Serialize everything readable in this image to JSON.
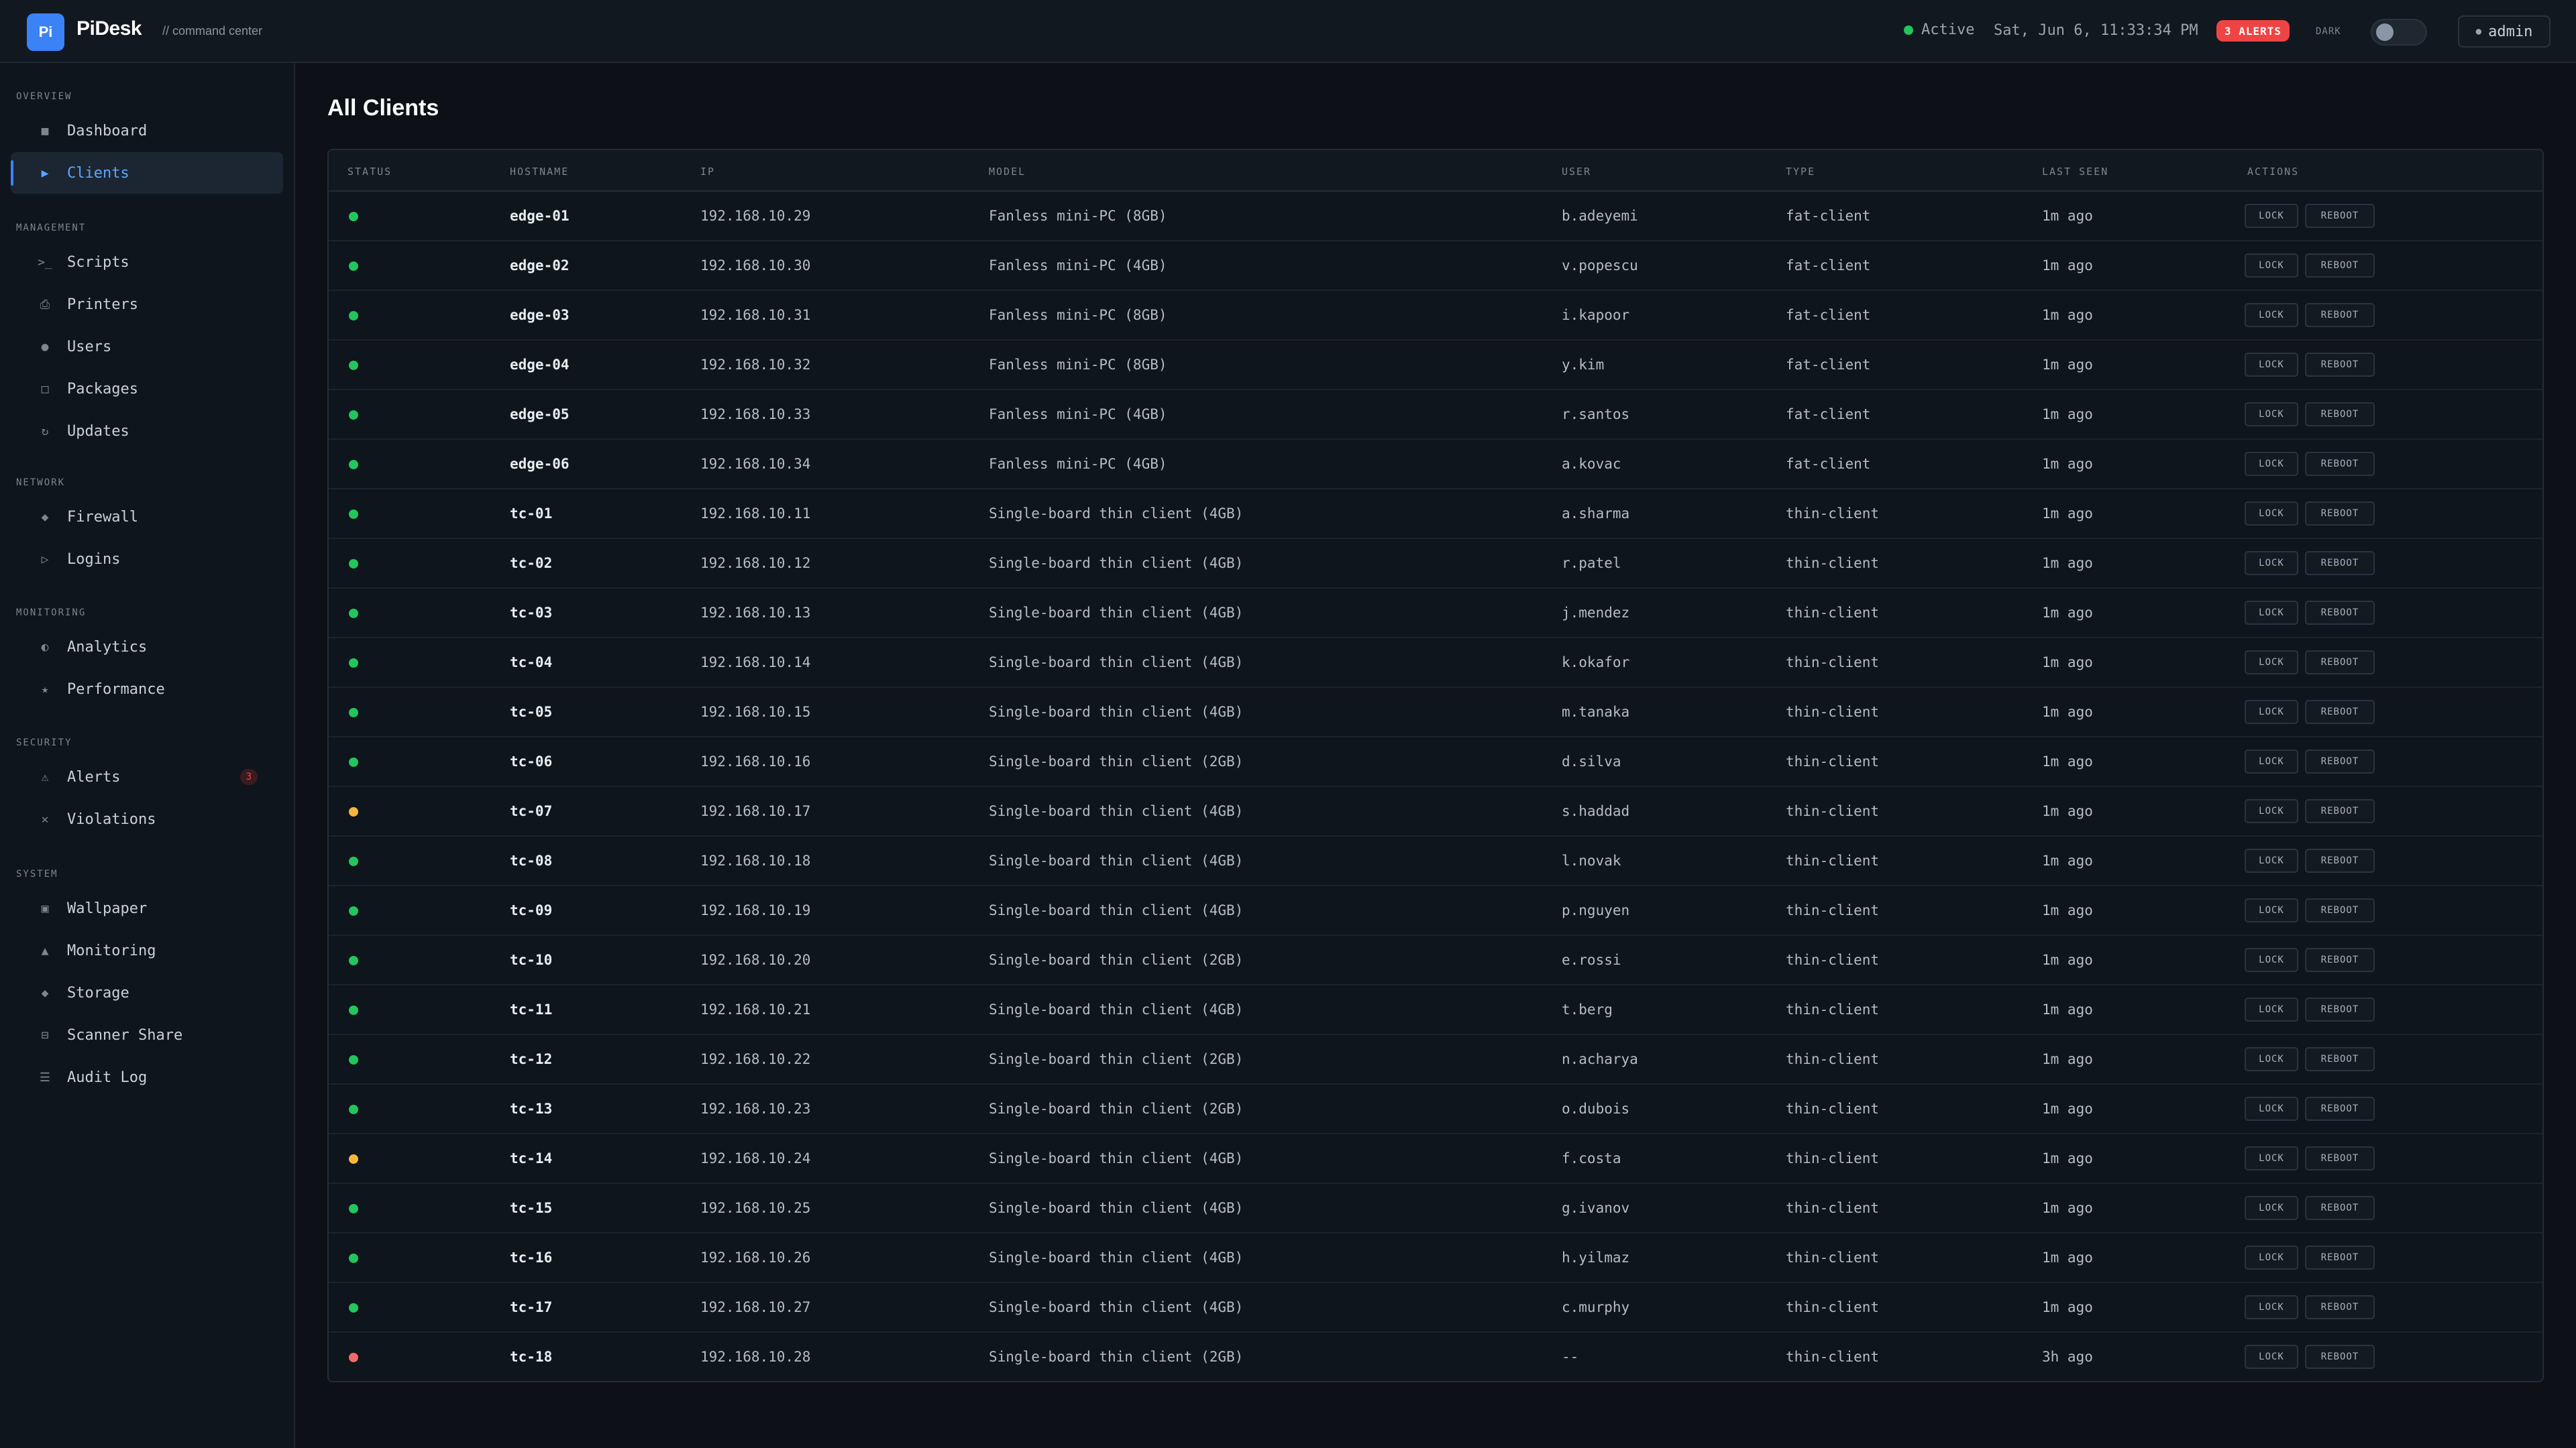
{
  "header": {
    "logo_text": "Pi",
    "brand": "PiDesk",
    "subtitle": "// command center",
    "status": "Active",
    "datetime": "Sat, Jun 6, 11:33:34 PM",
    "alerts_badge": "3 ALERTS",
    "dark_label": "DARK",
    "user": "admin"
  },
  "sidebar": {
    "sections": [
      {
        "label": "OVERVIEW",
        "items": [
          {
            "label": "Dashboard",
            "icon": "■"
          },
          {
            "label": "Clients",
            "icon": "▶",
            "active": true
          }
        ]
      },
      {
        "label": "MANAGEMENT",
        "items": [
          {
            "label": "Scripts",
            "icon": ">_"
          },
          {
            "label": "Printers",
            "icon": "⎙"
          },
          {
            "label": "Users",
            "icon": "●"
          },
          {
            "label": "Packages",
            "icon": "□"
          },
          {
            "label": "Updates",
            "icon": "↻"
          }
        ]
      },
      {
        "label": "NETWORK",
        "items": [
          {
            "label": "Firewall",
            "icon": "◆"
          },
          {
            "label": "Logins",
            "icon": "▷"
          }
        ]
      },
      {
        "label": "MONITORING",
        "items": [
          {
            "label": "Analytics",
            "icon": "◐"
          },
          {
            "label": "Performance",
            "icon": "★"
          }
        ]
      },
      {
        "label": "SECURITY",
        "items": [
          {
            "label": "Alerts",
            "icon": "⚠",
            "badge": "3"
          },
          {
            "label": "Violations",
            "icon": "✕"
          }
        ]
      },
      {
        "label": "SYSTEM",
        "items": [
          {
            "label": "Wallpaper",
            "icon": "▣"
          },
          {
            "label": "Monitoring",
            "icon": "▲"
          },
          {
            "label": "Storage",
            "icon": "◆"
          },
          {
            "label": "Scanner Share",
            "icon": "⊟"
          },
          {
            "label": "Audit Log",
            "icon": "☰"
          }
        ]
      }
    ]
  },
  "main": {
    "title": "All Clients",
    "columns": [
      "STATUS",
      "HOSTNAME",
      "IP",
      "MODEL",
      "USER",
      "TYPE",
      "LAST SEEN",
      "ACTIONS"
    ],
    "lock_label": "LOCK",
    "reboot_label": "REBOOT",
    "status_colors": {
      "online": "#22c55e",
      "warning": "#f5b73b",
      "offline": "#f06a6a"
    },
    "rows": [
      {
        "status": "online",
        "hostname": "edge-01",
        "ip": "192.168.10.29",
        "model": "Fanless mini-PC (8GB)",
        "user": "b.adeyemi",
        "type": "fat-client",
        "last_seen": "1m ago"
      },
      {
        "status": "online",
        "hostname": "edge-02",
        "ip": "192.168.10.30",
        "model": "Fanless mini-PC (4GB)",
        "user": "v.popescu",
        "type": "fat-client",
        "last_seen": "1m ago"
      },
      {
        "status": "online",
        "hostname": "edge-03",
        "ip": "192.168.10.31",
        "model": "Fanless mini-PC (8GB)",
        "user": "i.kapoor",
        "type": "fat-client",
        "last_seen": "1m ago"
      },
      {
        "status": "online",
        "hostname": "edge-04",
        "ip": "192.168.10.32",
        "model": "Fanless mini-PC (8GB)",
        "user": "y.kim",
        "type": "fat-client",
        "last_seen": "1m ago"
      },
      {
        "status": "online",
        "hostname": "edge-05",
        "ip": "192.168.10.33",
        "model": "Fanless mini-PC (4GB)",
        "user": "r.santos",
        "type": "fat-client",
        "last_seen": "1m ago"
      },
      {
        "status": "online",
        "hostname": "edge-06",
        "ip": "192.168.10.34",
        "model": "Fanless mini-PC (4GB)",
        "user": "a.kovac",
        "type": "fat-client",
        "last_seen": "1m ago"
      },
      {
        "status": "online",
        "hostname": "tc-01",
        "ip": "192.168.10.11",
        "model": "Single-board thin client (4GB)",
        "user": "a.sharma",
        "type": "thin-client",
        "last_seen": "1m ago"
      },
      {
        "status": "online",
        "hostname": "tc-02",
        "ip": "192.168.10.12",
        "model": "Single-board thin client (4GB)",
        "user": "r.patel",
        "type": "thin-client",
        "last_seen": "1m ago"
      },
      {
        "status": "online",
        "hostname": "tc-03",
        "ip": "192.168.10.13",
        "model": "Single-board thin client (4GB)",
        "user": "j.mendez",
        "type": "thin-client",
        "last_seen": "1m ago"
      },
      {
        "status": "online",
        "hostname": "tc-04",
        "ip": "192.168.10.14",
        "model": "Single-board thin client (4GB)",
        "user": "k.okafor",
        "type": "thin-client",
        "last_seen": "1m ago"
      },
      {
        "status": "online",
        "hostname": "tc-05",
        "ip": "192.168.10.15",
        "model": "Single-board thin client (4GB)",
        "user": "m.tanaka",
        "type": "thin-client",
        "last_seen": "1m ago"
      },
      {
        "status": "online",
        "hostname": "tc-06",
        "ip": "192.168.10.16",
        "model": "Single-board thin client (2GB)",
        "user": "d.silva",
        "type": "thin-client",
        "last_seen": "1m ago"
      },
      {
        "status": "warning",
        "hostname": "tc-07",
        "ip": "192.168.10.17",
        "model": "Single-board thin client (4GB)",
        "user": "s.haddad",
        "type": "thin-client",
        "last_seen": "1m ago"
      },
      {
        "status": "online",
        "hostname": "tc-08",
        "ip": "192.168.10.18",
        "model": "Single-board thin client (4GB)",
        "user": "l.novak",
        "type": "thin-client",
        "last_seen": "1m ago"
      },
      {
        "status": "online",
        "hostname": "tc-09",
        "ip": "192.168.10.19",
        "model": "Single-board thin client (4GB)",
        "user": "p.nguyen",
        "type": "thin-client",
        "last_seen": "1m ago"
      },
      {
        "status": "online",
        "hostname": "tc-10",
        "ip": "192.168.10.20",
        "model": "Single-board thin client (2GB)",
        "user": "e.rossi",
        "type": "thin-client",
        "last_seen": "1m ago"
      },
      {
        "status": "online",
        "hostname": "tc-11",
        "ip": "192.168.10.21",
        "model": "Single-board thin client (4GB)",
        "user": "t.berg",
        "type": "thin-client",
        "last_seen": "1m ago"
      },
      {
        "status": "online",
        "hostname": "tc-12",
        "ip": "192.168.10.22",
        "model": "Single-board thin client (2GB)",
        "user": "n.acharya",
        "type": "thin-client",
        "last_seen": "1m ago"
      },
      {
        "status": "online",
        "hostname": "tc-13",
        "ip": "192.168.10.23",
        "model": "Single-board thin client (2GB)",
        "user": "o.dubois",
        "type": "thin-client",
        "last_seen": "1m ago"
      },
      {
        "status": "warning",
        "hostname": "tc-14",
        "ip": "192.168.10.24",
        "model": "Single-board thin client (4GB)",
        "user": "f.costa",
        "type": "thin-client",
        "last_seen": "1m ago"
      },
      {
        "status": "online",
        "hostname": "tc-15",
        "ip": "192.168.10.25",
        "model": "Single-board thin client (4GB)",
        "user": "g.ivanov",
        "type": "thin-client",
        "last_seen": "1m ago"
      },
      {
        "status": "online",
        "hostname": "tc-16",
        "ip": "192.168.10.26",
        "model": "Single-board thin client (4GB)",
        "user": "h.yilmaz",
        "type": "thin-client",
        "last_seen": "1m ago"
      },
      {
        "status": "online",
        "hostname": "tc-17",
        "ip": "192.168.10.27",
        "model": "Single-board thin client (4GB)",
        "user": "c.murphy",
        "type": "thin-client",
        "last_seen": "1m ago"
      },
      {
        "status": "offline",
        "hostname": "tc-18",
        "ip": "192.168.10.28",
        "model": "Single-board thin client (2GB)",
        "user": "--",
        "type": "thin-client",
        "last_seen": "3h ago"
      }
    ]
  }
}
